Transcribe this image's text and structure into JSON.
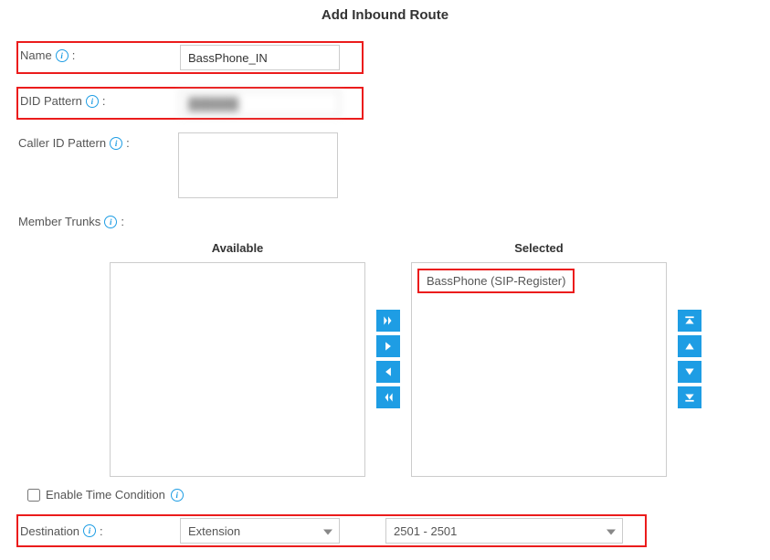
{
  "title": "Add Inbound Route",
  "fields": {
    "name": {
      "label": "Name",
      "value": "BassPhone_IN"
    },
    "didPattern": {
      "label": "DID Pattern",
      "value": "██████"
    },
    "callerIdPattern": {
      "label": "Caller ID Pattern",
      "value": ""
    },
    "memberTrunks": {
      "label": "Member Trunks"
    }
  },
  "transfer": {
    "availableHeader": "Available",
    "selectedHeader": "Selected",
    "availableItems": [],
    "selectedItems": [
      "BassPhone (SIP-Register)"
    ]
  },
  "timeCondition": {
    "label": "Enable Time Condition",
    "checked": false
  },
  "destination": {
    "label": "Destination",
    "type": "Extension",
    "target": "2501 - 2501"
  }
}
